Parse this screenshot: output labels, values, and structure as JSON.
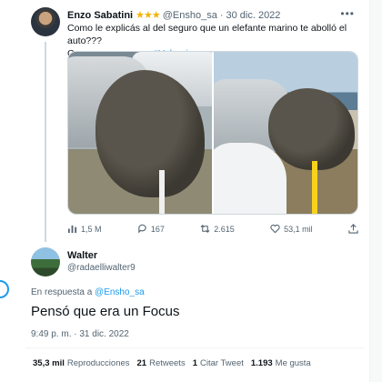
{
  "tweet1": {
    "name": "Enzo Sabatini",
    "badge": "★★★",
    "handle": "@Ensho_sa",
    "sep": "·",
    "date": "30 dic. 2022",
    "more": "•••",
    "text_line1": "Como le explicás al del seguro que un elefante marino te abolló el auto???",
    "text_line2": "Cosa que pasan en ",
    "hashtag": "#Ushuaia",
    "actions": {
      "views": "1,5 M",
      "replies": "167",
      "retweets": "2.615",
      "likes": "53,1 mil"
    }
  },
  "tweet2": {
    "name": "Walter",
    "handle": "@radaelliwalter9",
    "reply_prefix": "En respuesta a ",
    "reply_mention": "@Ensho_sa",
    "text": "Pensó que era un Focus",
    "time": "9:49 p. m. · 31 dic. 2022",
    "stats": [
      {
        "value": "35,3 mil",
        "label": "Reproducciones"
      },
      {
        "value": "21",
        "label": "Retweets"
      },
      {
        "value": "1",
        "label": "Citar Tweet"
      },
      {
        "value": "1.193",
        "label": "Me gusta"
      }
    ]
  },
  "colors": {
    "accent": "#1d9bf0",
    "muted": "#536471",
    "badge": "#f4b400"
  }
}
